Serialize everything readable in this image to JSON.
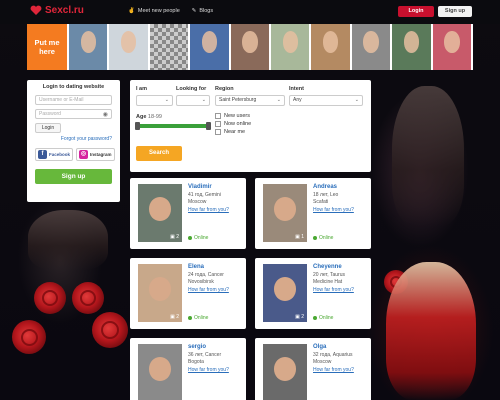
{
  "site": {
    "brand": "Sexcl.ru"
  },
  "header": {
    "nav": [
      {
        "label": "Meet new people",
        "icon": "handshake-icon"
      },
      {
        "label": "Blogs",
        "icon": "pen-icon"
      }
    ],
    "login_label": "Login",
    "signup_label": "Sign up"
  },
  "strip": {
    "promo_label": "Put me here"
  },
  "login_box": {
    "title": "Login to dating website",
    "username_placeholder": "Username or E-Mail",
    "password_placeholder": "Password",
    "login_button": "Login",
    "forgot_link": "Forgot your password?",
    "facebook_label": "Facebook",
    "instagram_label": "Instagram",
    "signup_button": "Sign up"
  },
  "search": {
    "i_am_label": "I am",
    "looking_for_label": "Looking for",
    "region_label": "Region",
    "region_value": "Saint Petersburg",
    "intent_label": "Intent",
    "intent_value": "Any",
    "age_label": "Age",
    "age_value": "18-99",
    "checkboxes": [
      "New users",
      "Now online",
      "Near me"
    ],
    "search_button": "Search"
  },
  "profiles": [
    {
      "name": "Vladimir",
      "age_sign": "41 год, Gemini",
      "city": "Moscow",
      "link": "How far from you?",
      "photos": "2",
      "status": "Online"
    },
    {
      "name": "Andreas",
      "age_sign": "18 лет, Leo",
      "city": "Scafati",
      "link": "How far from you?",
      "photos": "1",
      "status": "Online"
    },
    {
      "name": "Elena",
      "age_sign": "24 года, Cancer",
      "city": "Novosibirsk",
      "link": "How far from you?",
      "photos": "2",
      "status": "Online"
    },
    {
      "name": "Cheyenne",
      "age_sign": "20 лет, Taurus",
      "city": "Medicine Hat",
      "link": "How far from you?",
      "photos": "2",
      "status": "Online"
    },
    {
      "name": "sergio",
      "age_sign": "36 лет, Cancer",
      "city": "Bogota",
      "link": "How far from you?",
      "photos": "",
      "status": ""
    },
    {
      "name": "Olga",
      "age_sign": "32 года, Aquarius",
      "city": "Moscow",
      "link": "How far from you?",
      "photos": "",
      "status": ""
    }
  ],
  "colors": {
    "brand_red": "#c8102e",
    "promo_orange": "#f47b20",
    "signup_green": "#67b83b",
    "search_orange": "#f5a623",
    "link_blue": "#2a6ebb"
  }
}
